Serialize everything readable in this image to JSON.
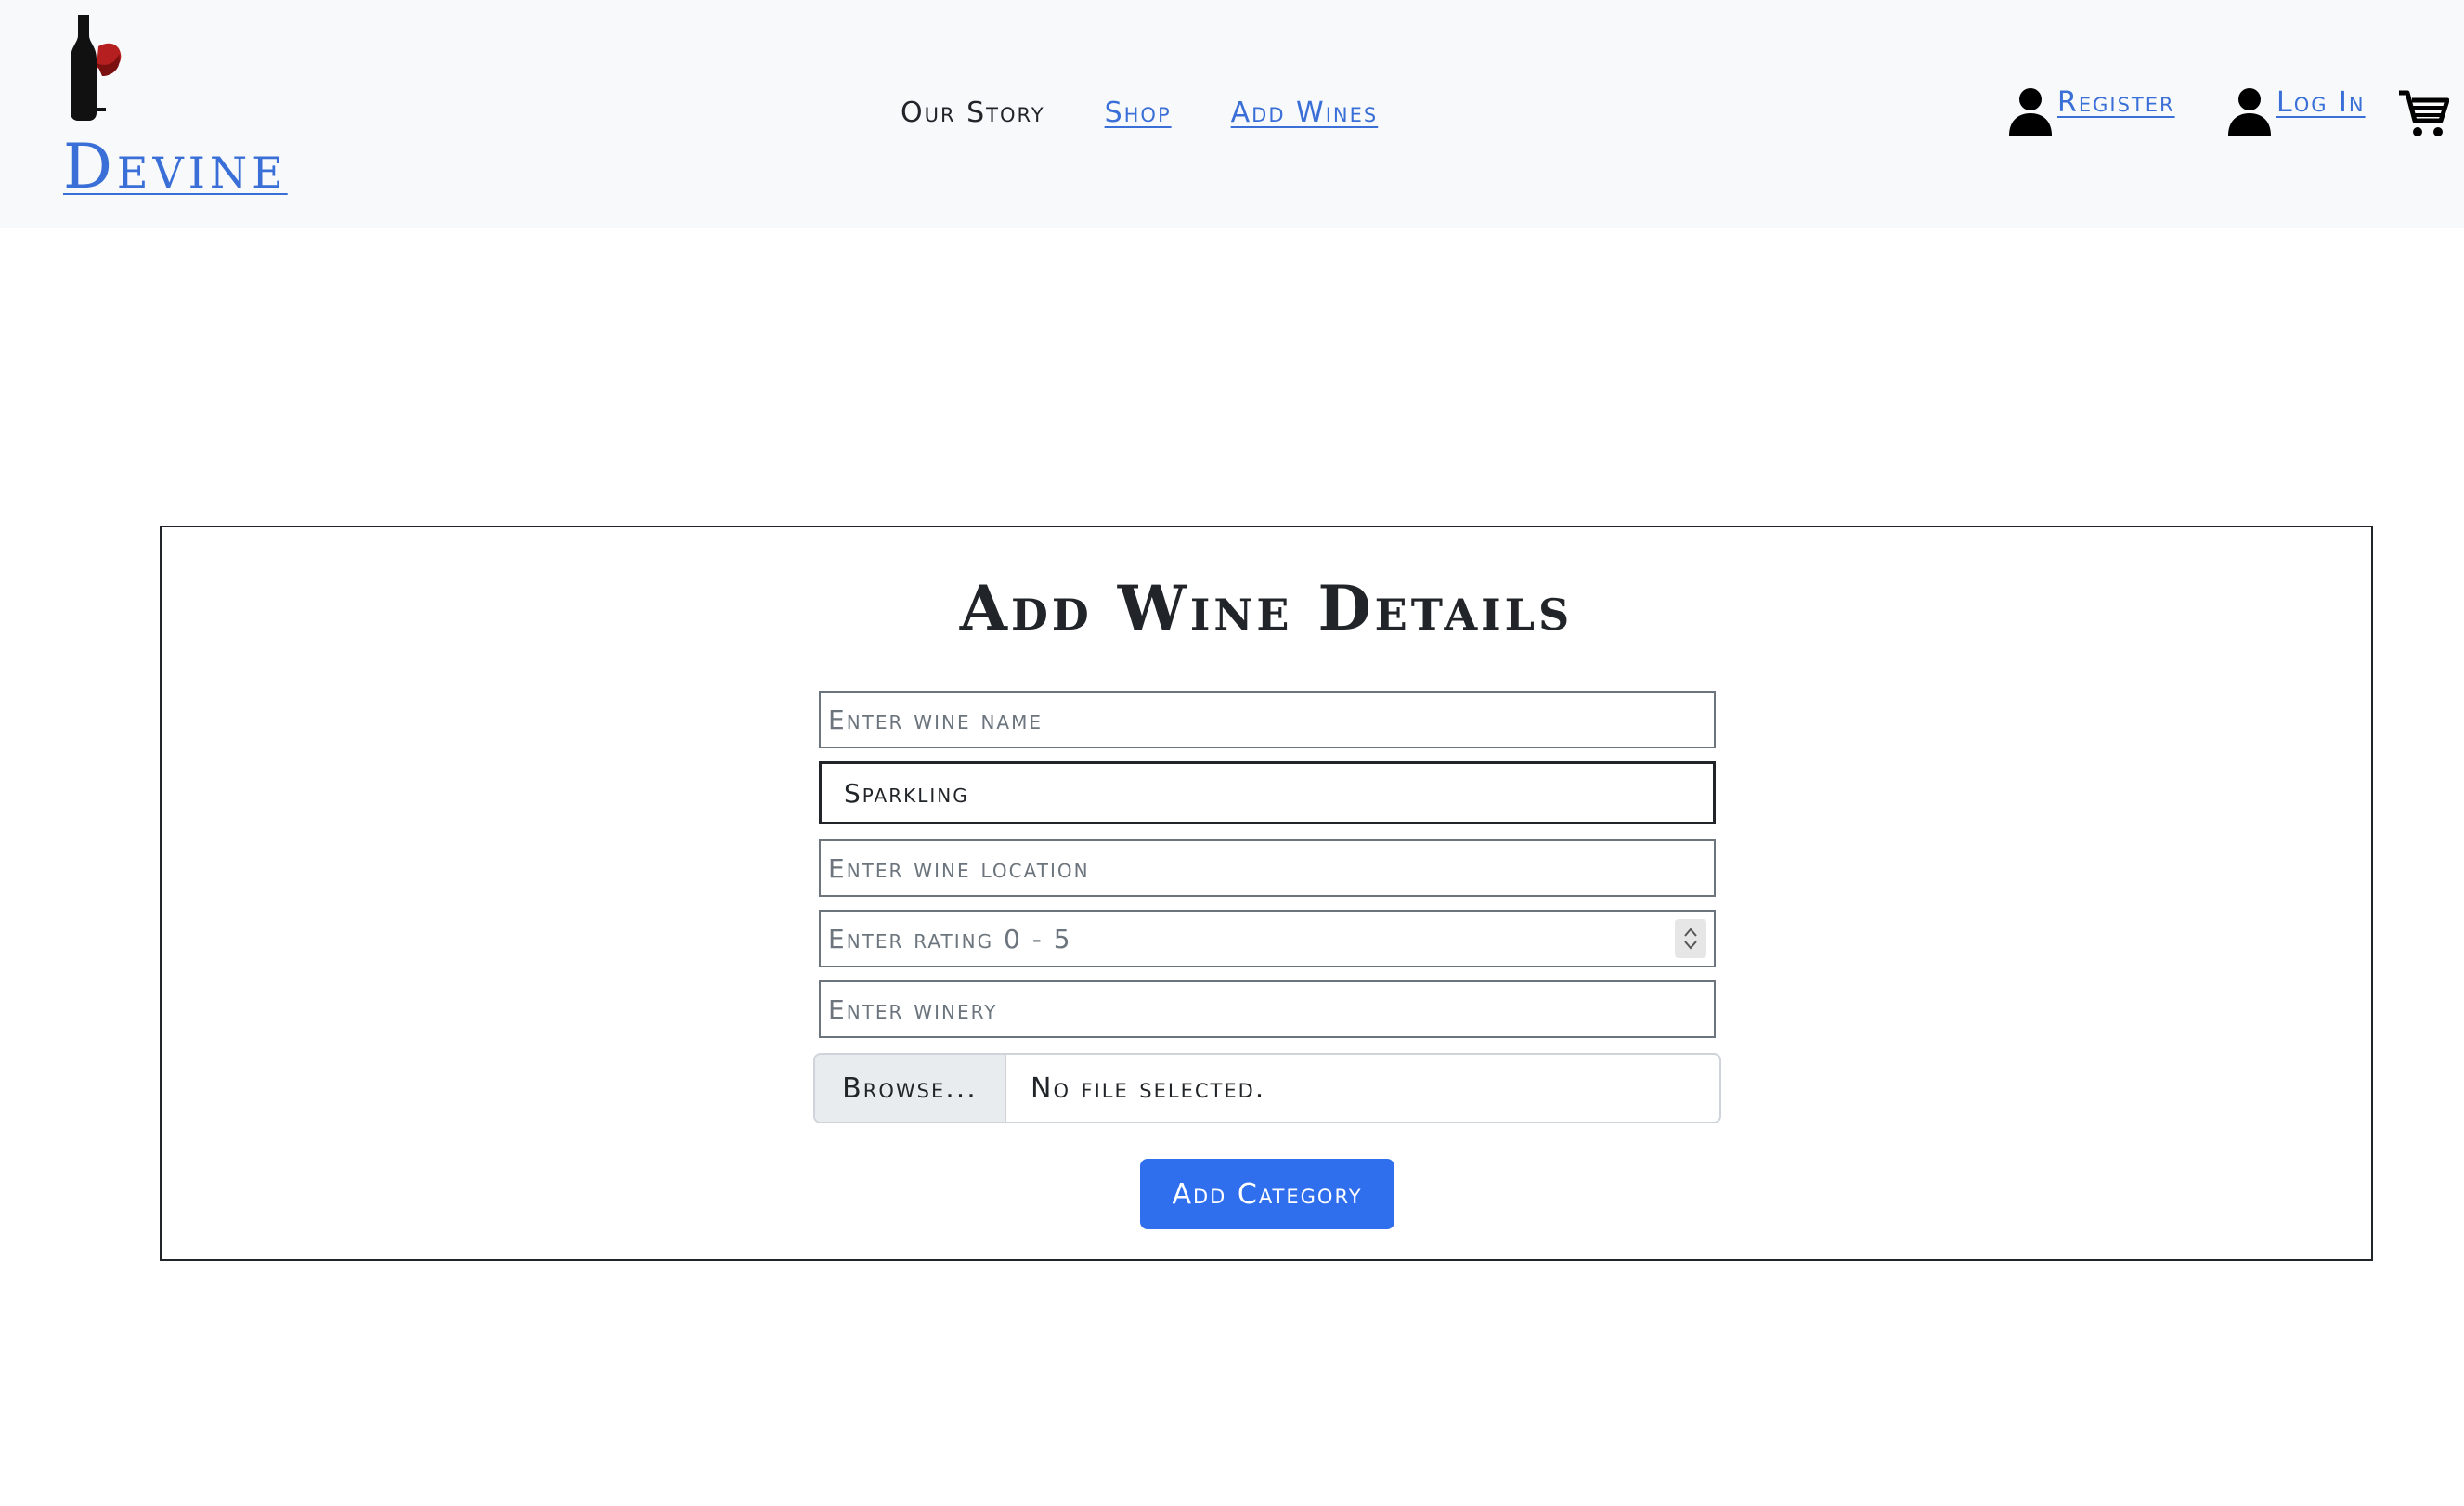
{
  "header": {
    "brand": "Devine",
    "logo_icon": "wine-bottle-glass-logo",
    "nav": {
      "our_story": "Our Story",
      "shop": "Shop",
      "add_wines": "Add Wines"
    },
    "register": "Register",
    "login": "Log In",
    "cart_icon": "shopping-cart-icon"
  },
  "form": {
    "title": "Add Wine Details",
    "wine_name_placeholder": "Enter wine name",
    "category_value": "Sparkling",
    "location_placeholder": "Enter wine location",
    "rating_placeholder": "Enter rating 0 - 5",
    "winery_placeholder": "Enter winery",
    "browse_label": "Browse...",
    "file_status": "No file selected.",
    "submit_label": "Add Category"
  },
  "colors": {
    "link": "#3a6fd8",
    "primary_button": "#2f6fed",
    "header_bg": "#f8f9fa"
  }
}
